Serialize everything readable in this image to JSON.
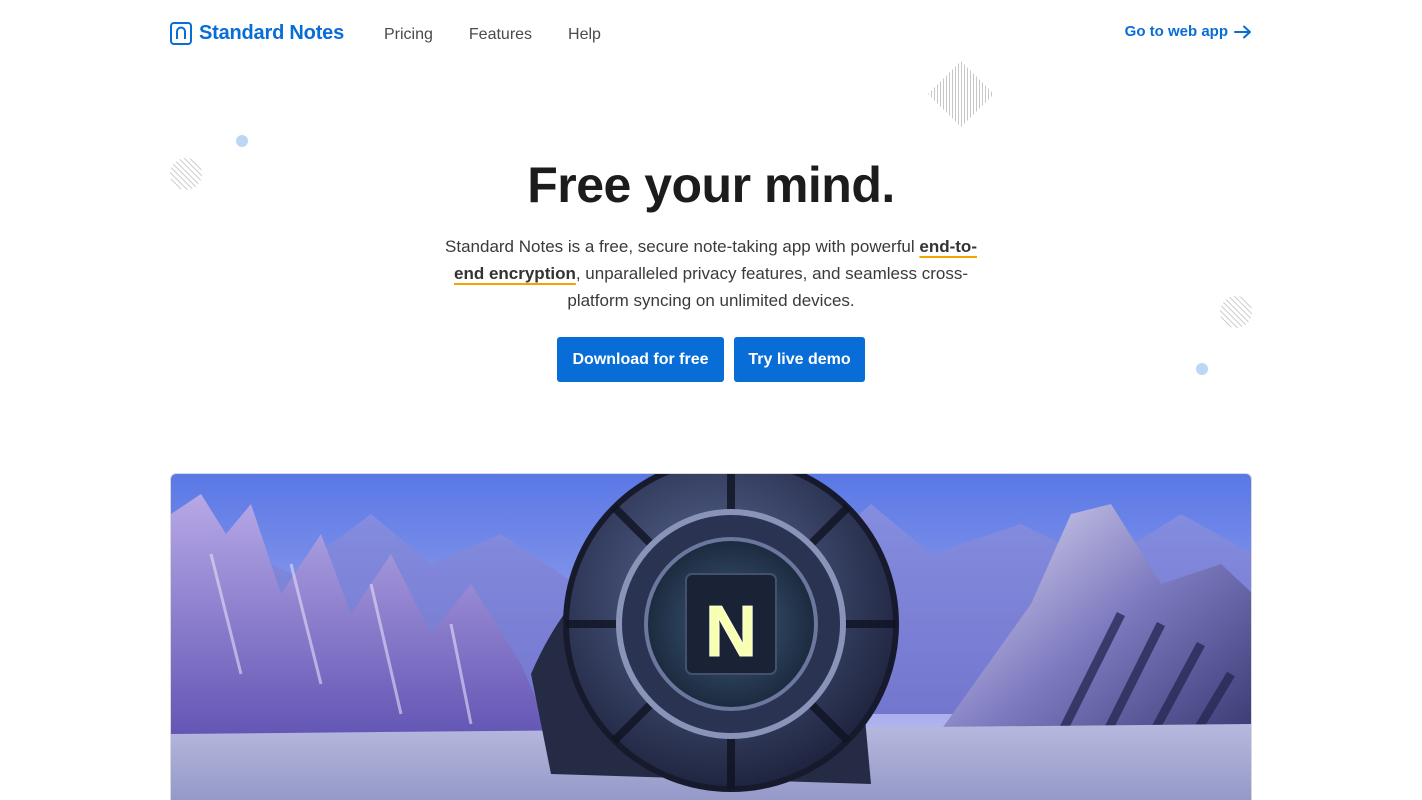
{
  "header": {
    "brand_name": "Standard Notes",
    "nav": [
      {
        "label": "Pricing"
      },
      {
        "label": "Features"
      },
      {
        "label": "Help"
      }
    ],
    "web_app_link": "Go to web app"
  },
  "hero": {
    "title": "Free your mind.",
    "text_before": "Standard Notes is a free, secure note-taking app with powerful ",
    "text_highlight": "end-to-end encryption",
    "text_after": ", unparalleled privacy features, and seamless cross-platform syncing on unlimited devices.",
    "buttons": {
      "download": "Download for free",
      "demo": "Try live demo"
    },
    "image_emblem_letter": "N"
  },
  "colors": {
    "brand": "#086dd6",
    "highlight_underline": "#f0a500",
    "decor_dot": "#bcd6f6"
  }
}
